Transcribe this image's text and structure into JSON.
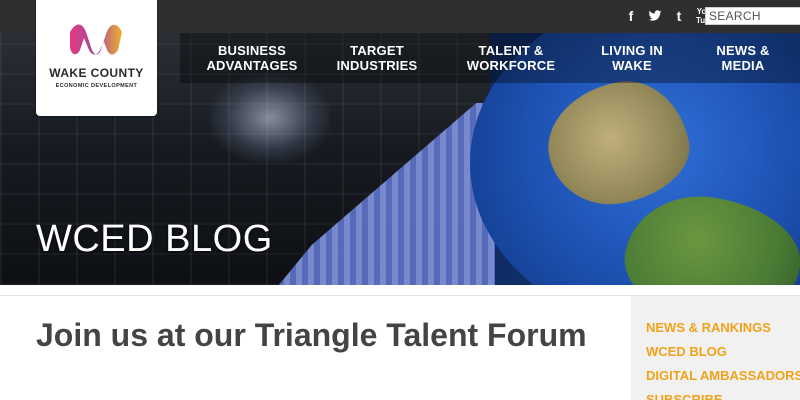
{
  "brand": {
    "name": "WAKE COUNTY",
    "subtitle": "ECONOMIC DEVELOPMENT"
  },
  "topbar": {
    "social": [
      "f",
      "t",
      "t",
      "You Tube"
    ],
    "search_placeholder": "SEARCH"
  },
  "nav": {
    "items": [
      {
        "label": "BUSINESS\nADVANTAGES"
      },
      {
        "label": "TARGET\nINDUSTRIES"
      },
      {
        "label": "TALENT &\nWORKFORCE"
      },
      {
        "label": "LIVING IN\nWAKE"
      },
      {
        "label": "NEWS &\nMEDIA"
      }
    ]
  },
  "hero": {
    "title": "WCED BLOG"
  },
  "post": {
    "title": "Join us at our Triangle Talent Forum"
  },
  "sidebar": {
    "links": [
      "NEWS & RANKINGS",
      "WCED BLOG",
      "DIGITAL AMBASSADORS",
      "SUBSCRIBE"
    ]
  },
  "colors": {
    "topbar": "#2f2f2f",
    "sidebar_link": "#f0a31a",
    "title_text": "#444444"
  }
}
